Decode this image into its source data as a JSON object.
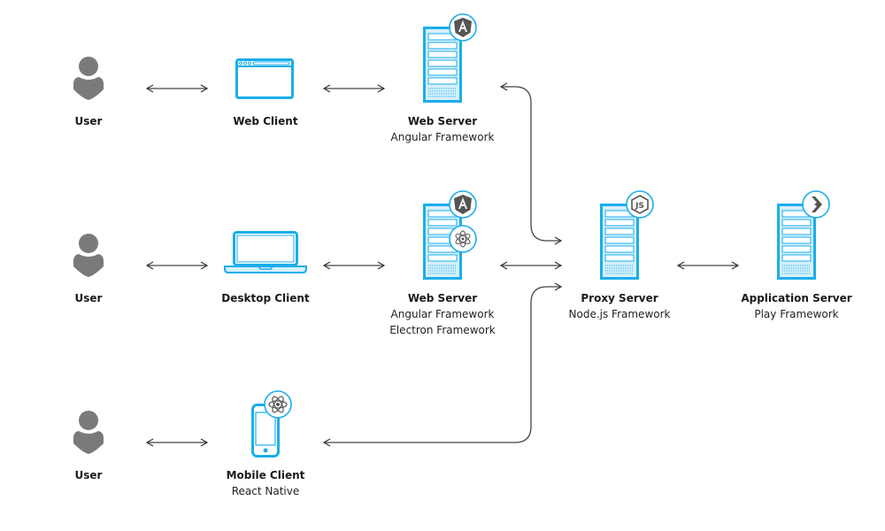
{
  "colors": {
    "accent": "#1aaeec",
    "accent_light": "#d6f0fb",
    "user_gray": "#7a7a7a",
    "badge_gray": "#5a5a5a",
    "line": "#333333"
  },
  "rows": [
    {
      "user": {
        "title": "User",
        "icon": "user-icon"
      },
      "client": {
        "title": "Web Client",
        "subtitle": "",
        "icon": "browser-window-icon"
      },
      "server": {
        "title": "Web Server",
        "subtitles": [
          "Angular Framework"
        ],
        "icon": "server-rack-icon",
        "badges": [
          "angular-icon"
        ]
      }
    },
    {
      "user": {
        "title": "User",
        "icon": "user-icon"
      },
      "client": {
        "title": "Desktop Client",
        "subtitle": "",
        "icon": "laptop-icon"
      },
      "server": {
        "title": "Web Server",
        "subtitles": [
          "Angular Framework",
          "Electron Framework"
        ],
        "icon": "server-rack-icon",
        "badges": [
          "angular-icon",
          "electron-icon"
        ]
      }
    },
    {
      "user": {
        "title": "User",
        "icon": "user-icon"
      },
      "client": {
        "title": "Mobile Client",
        "subtitle": "React Native",
        "icon": "smartphone-icon",
        "badges": [
          "react-icon"
        ]
      }
    }
  ],
  "proxy": {
    "title": "Proxy Server",
    "subtitle": "Node.js Framework",
    "icon": "server-rack-icon",
    "badge": "nodejs-icon"
  },
  "app": {
    "title": "Application Server",
    "subtitle": "Play Framework",
    "icon": "server-rack-icon",
    "badge": "play-framework-icon"
  }
}
